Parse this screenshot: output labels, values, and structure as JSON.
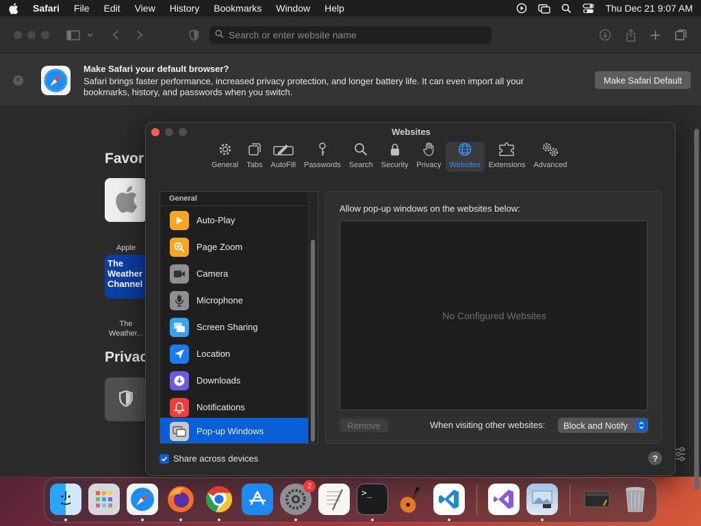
{
  "menubar": {
    "app_name": "Safari",
    "items": [
      "File",
      "Edit",
      "View",
      "History",
      "Bookmarks",
      "Window",
      "Help"
    ],
    "datetime": "Thu Dec 21  9:07 AM"
  },
  "toolbar": {
    "search_placeholder": "Search or enter website name"
  },
  "banner": {
    "title": "Make Safari your default browser?",
    "body": "Safari brings faster performance, increased privacy protection, and longer battery life. It can even import all your bookmarks, history, and passwords when you switch.",
    "button_label": "Make Safari Default"
  },
  "start_page": {
    "favorites_heading": "Favor",
    "privacy_heading": "Privac",
    "tiles": [
      {
        "label": "Apple"
      },
      {
        "label": "The Weather...",
        "tile_text": "The Weather Channel"
      }
    ]
  },
  "prefs": {
    "title": "Websites",
    "tabs": [
      {
        "label": "General",
        "icon": "gear-icon"
      },
      {
        "label": "Tabs",
        "icon": "tabs-icon"
      },
      {
        "label": "AutoFill",
        "icon": "pencil-icon"
      },
      {
        "label": "Passwords",
        "icon": "key-icon"
      },
      {
        "label": "Search",
        "icon": "search-icon"
      },
      {
        "label": "Security",
        "icon": "lock-icon"
      },
      {
        "label": "Privacy",
        "icon": "hand-icon"
      },
      {
        "label": "Websites",
        "icon": "globe-icon"
      },
      {
        "label": "Extensions",
        "icon": "puzzle-icon"
      },
      {
        "label": "Advanced",
        "icon": "gears-icon"
      }
    ],
    "active_tab": "Websites",
    "sidebar": {
      "section": "General",
      "items": [
        {
          "label": "Auto-Play",
          "icon": "play-icon",
          "color": "#f5a623"
        },
        {
          "label": "Page Zoom",
          "icon": "zoom-icon",
          "color": "#f5a623"
        },
        {
          "label": "Camera",
          "icon": "camera-icon",
          "color": "#8e8e93"
        },
        {
          "label": "Microphone",
          "icon": "microphone-icon",
          "color": "#8e8e93"
        },
        {
          "label": "Screen Sharing",
          "icon": "screen-sharing-icon",
          "color": "#3aa0f0"
        },
        {
          "label": "Location",
          "icon": "location-icon",
          "color": "#1a7cf0"
        },
        {
          "label": "Downloads",
          "icon": "downloads-icon",
          "color": "#6a5de0"
        },
        {
          "label": "Notifications",
          "icon": "bell-icon",
          "color": "#f23b3b"
        },
        {
          "label": "Pop-up Windows",
          "icon": "popup-icon",
          "color": "#8e8e93"
        }
      ],
      "selected": "Pop-up Windows"
    },
    "panel": {
      "heading": "Allow pop-up windows on the websites below:",
      "empty_text": "No Configured Websites",
      "remove_label": "Remove",
      "other_label": "When visiting other websites:",
      "policy_value": "Block and Notify"
    },
    "share_label": "Share across devices",
    "share_checked": true,
    "help_label": "?"
  },
  "dock": {
    "apps": [
      {
        "name": "finder",
        "icon": "finder-icon"
      },
      {
        "name": "launchpad",
        "icon": "launchpad-icon"
      },
      {
        "name": "safari",
        "icon": "safari-icon"
      },
      {
        "name": "firefox",
        "icon": "firefox-icon"
      },
      {
        "name": "chrome",
        "icon": "chrome-icon"
      },
      {
        "name": "app-store",
        "icon": "app-store-icon"
      },
      {
        "name": "system-settings",
        "icon": "settings-icon",
        "badge": "2"
      },
      {
        "name": "textedit",
        "icon": "textedit-icon"
      },
      {
        "name": "terminal",
        "icon": "terminal-icon",
        "text": ">_"
      },
      {
        "name": "garageband",
        "icon": "guitar-icon"
      },
      {
        "name": "vscode",
        "icon": "vscode-icon"
      },
      {
        "name": "visual-studio",
        "icon": "visual-studio-icon"
      },
      {
        "name": "preview",
        "icon": "preview-icon"
      },
      {
        "name": "recent-window",
        "icon": "window-icon"
      },
      {
        "name": "trash",
        "icon": "trash-icon"
      }
    ]
  },
  "colors": {
    "accent": "#0a5ed6",
    "active_tab": "#3b8df3"
  }
}
